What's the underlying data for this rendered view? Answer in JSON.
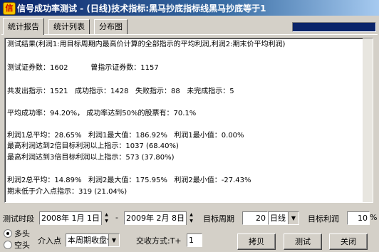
{
  "window": {
    "title": "信号成功率测试 - (日线)技术指标:黑马抄底指标线黑马抄底等于1"
  },
  "tabs": [
    {
      "label": "统计报告",
      "active": true
    },
    {
      "label": "统计列表",
      "active": false
    },
    {
      "label": "分布图",
      "active": false
    }
  ],
  "progress": {
    "fraction": 1.0
  },
  "report": {
    "lines": [
      "测试结果(利润1:用目标周期内最高价计算的全部指示的平均利润,利润2:期末价平均利润)",
      "",
      "测试证券数：1602          曾指示证券数：1157",
      "",
      "共发出指示：1521   成功指示：1428   失败指示：88   未完成指示：5",
      "",
      "平均成功率：94.20%， 成功率达到50%的股票有：70.1%",
      "",
      "利润1总平均：28.65%   利润1最大值：186.92%   利润1最小值：0.00%",
      "最高利润达到2倍目标利润以上指示：1037 (68.40%)",
      "最高利润达到3倍目标利润以上指示：573 (37.80%)",
      "",
      "利润2总平均：14.89%   利润2最大值：175.95%   利润2最小值：-27.43%",
      "期末低于介入点指示：319 (21.04%)"
    ]
  },
  "controls": {
    "period_label": "测试时段",
    "start_date": "2008年 1月 1日",
    "dash": "-",
    "end_date": "2009年 2月 8日",
    "target_period_label": "目标周期",
    "target_period_value": "20",
    "period_unit": "日线",
    "target_profit_label": "目标利润",
    "target_profit_value": "10",
    "percent": "%",
    "long_label": "多头",
    "short_label": "空头",
    "entry_label": "介入点",
    "entry_value": "本周期收盘价",
    "trade_mode_label": "交收方式:T+",
    "trade_mode_value": "1",
    "copy_button": "拷贝",
    "test_button": "测试",
    "close_button": "关闭"
  }
}
